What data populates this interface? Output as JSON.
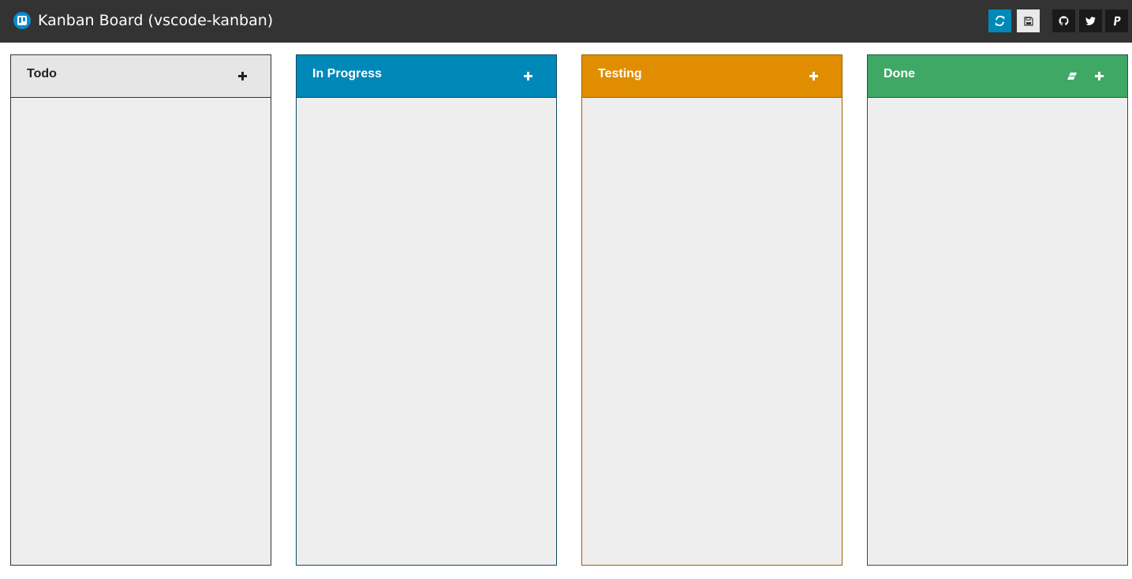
{
  "app": {
    "title": "Kanban Board (vscode-kanban)",
    "logo_icon": "trello-icon",
    "accent_color": "#0a8ad0"
  },
  "toolbar": {
    "buttons": [
      {
        "icon": "refresh-icon",
        "color": "#0088b8"
      },
      {
        "icon": "save-icon",
        "color": "#e9e9e9"
      },
      {
        "icon": "github-icon",
        "color": "#1a1a1a"
      },
      {
        "icon": "twitter-icon",
        "color": "#1a1a1a"
      },
      {
        "icon": "paypal-icon",
        "color": "#1a1a1a"
      }
    ]
  },
  "columns": [
    {
      "id": "todo",
      "title": "Todo",
      "header_color": "#e6e6e6",
      "border_color": "#333333",
      "text_color": "#222222",
      "add_icon": "plus-icon",
      "cards": []
    },
    {
      "id": "in-progress",
      "title": "In Progress",
      "header_color": "#0088b8",
      "border_color": "#0b4a63",
      "text_color": "#ffffff",
      "add_icon": "plus-icon",
      "cards": []
    },
    {
      "id": "testing",
      "title": "Testing",
      "header_color": "#e08e00",
      "border_color": "#9a6400",
      "text_color": "#ffffff",
      "add_icon": "plus-icon",
      "cards": []
    },
    {
      "id": "done",
      "title": "Done",
      "header_color": "#3fa865",
      "border_color": "#1e5a33",
      "text_color": "#ffffff",
      "add_icon": "plus-icon",
      "clear_icon": "eraser-icon",
      "cards": []
    }
  ]
}
